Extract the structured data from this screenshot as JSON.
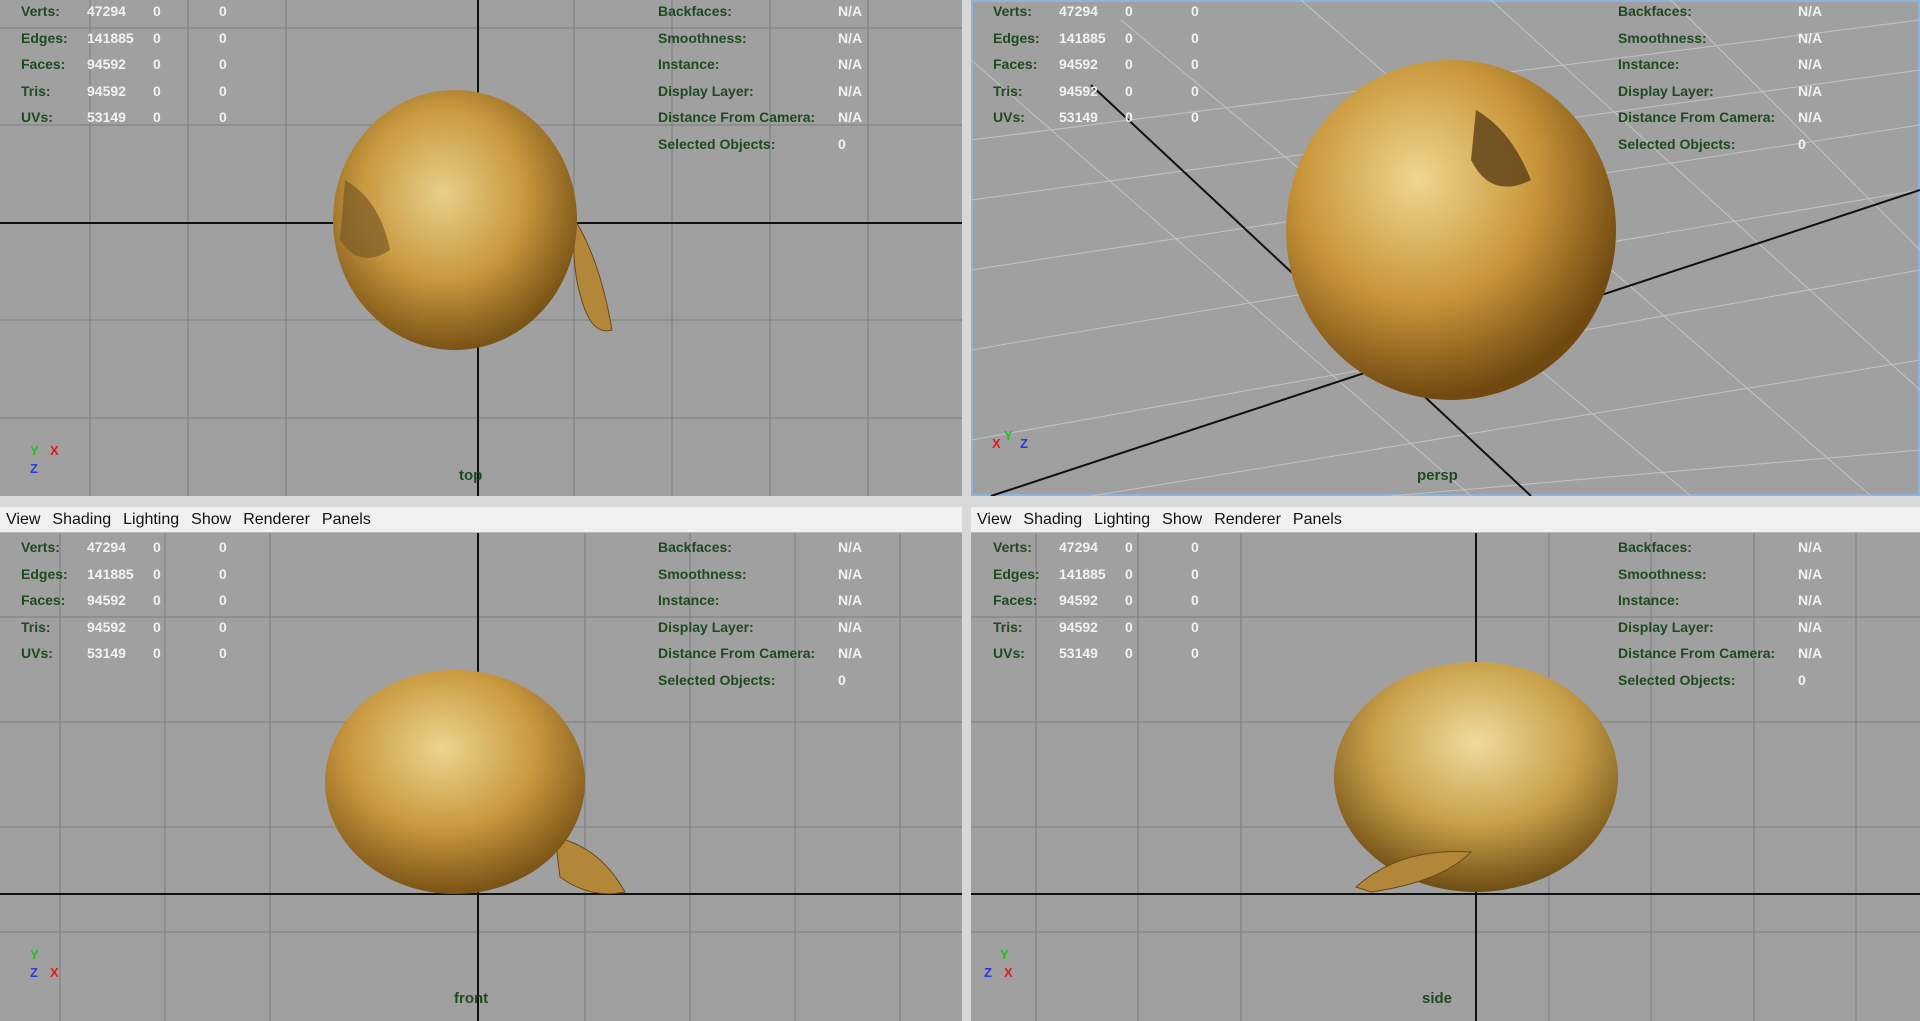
{
  "menu": [
    "View",
    "Shading",
    "Lighting",
    "Show",
    "Renderer",
    "Panels"
  ],
  "stats_left": [
    {
      "label": "Verts:",
      "v1": "47294",
      "v2": "0",
      "v3": "0"
    },
    {
      "label": "Edges:",
      "v1": "141885",
      "v2": "0",
      "v3": "0"
    },
    {
      "label": "Faces:",
      "v1": "94592",
      "v2": "0",
      "v3": "0"
    },
    {
      "label": "Tris:",
      "v1": "94592",
      "v2": "0",
      "v3": "0"
    },
    {
      "label": "UVs:",
      "v1": "53149",
      "v2": "0",
      "v3": "0"
    }
  ],
  "stats_right": [
    {
      "label": "Backfaces:",
      "value": "N/A"
    },
    {
      "label": "Smoothness:",
      "value": "N/A"
    },
    {
      "label": "Instance:",
      "value": "N/A"
    },
    {
      "label": "Display Layer:",
      "value": "N/A"
    },
    {
      "label": "Distance From Camera:",
      "value": "N/A"
    },
    {
      "label": "Selected Objects:",
      "value": "0"
    }
  ],
  "viewports": {
    "top": {
      "camera": "top",
      "axes": [
        "Y",
        "X",
        "Z"
      ]
    },
    "persp": {
      "camera": "persp",
      "axes": [
        "X",
        "Y",
        "Z"
      ]
    },
    "front": {
      "camera": "front",
      "axes": [
        "Y",
        "Z",
        "X"
      ]
    },
    "side": {
      "camera": "side",
      "axes": [
        "Y",
        "Z",
        "X"
      ]
    }
  },
  "colors": {
    "viewport_bg": "#a0a0a0",
    "hud_label": "#1f4a1f",
    "hud_value": "#f2f2f2",
    "onion": "#c89a48"
  }
}
